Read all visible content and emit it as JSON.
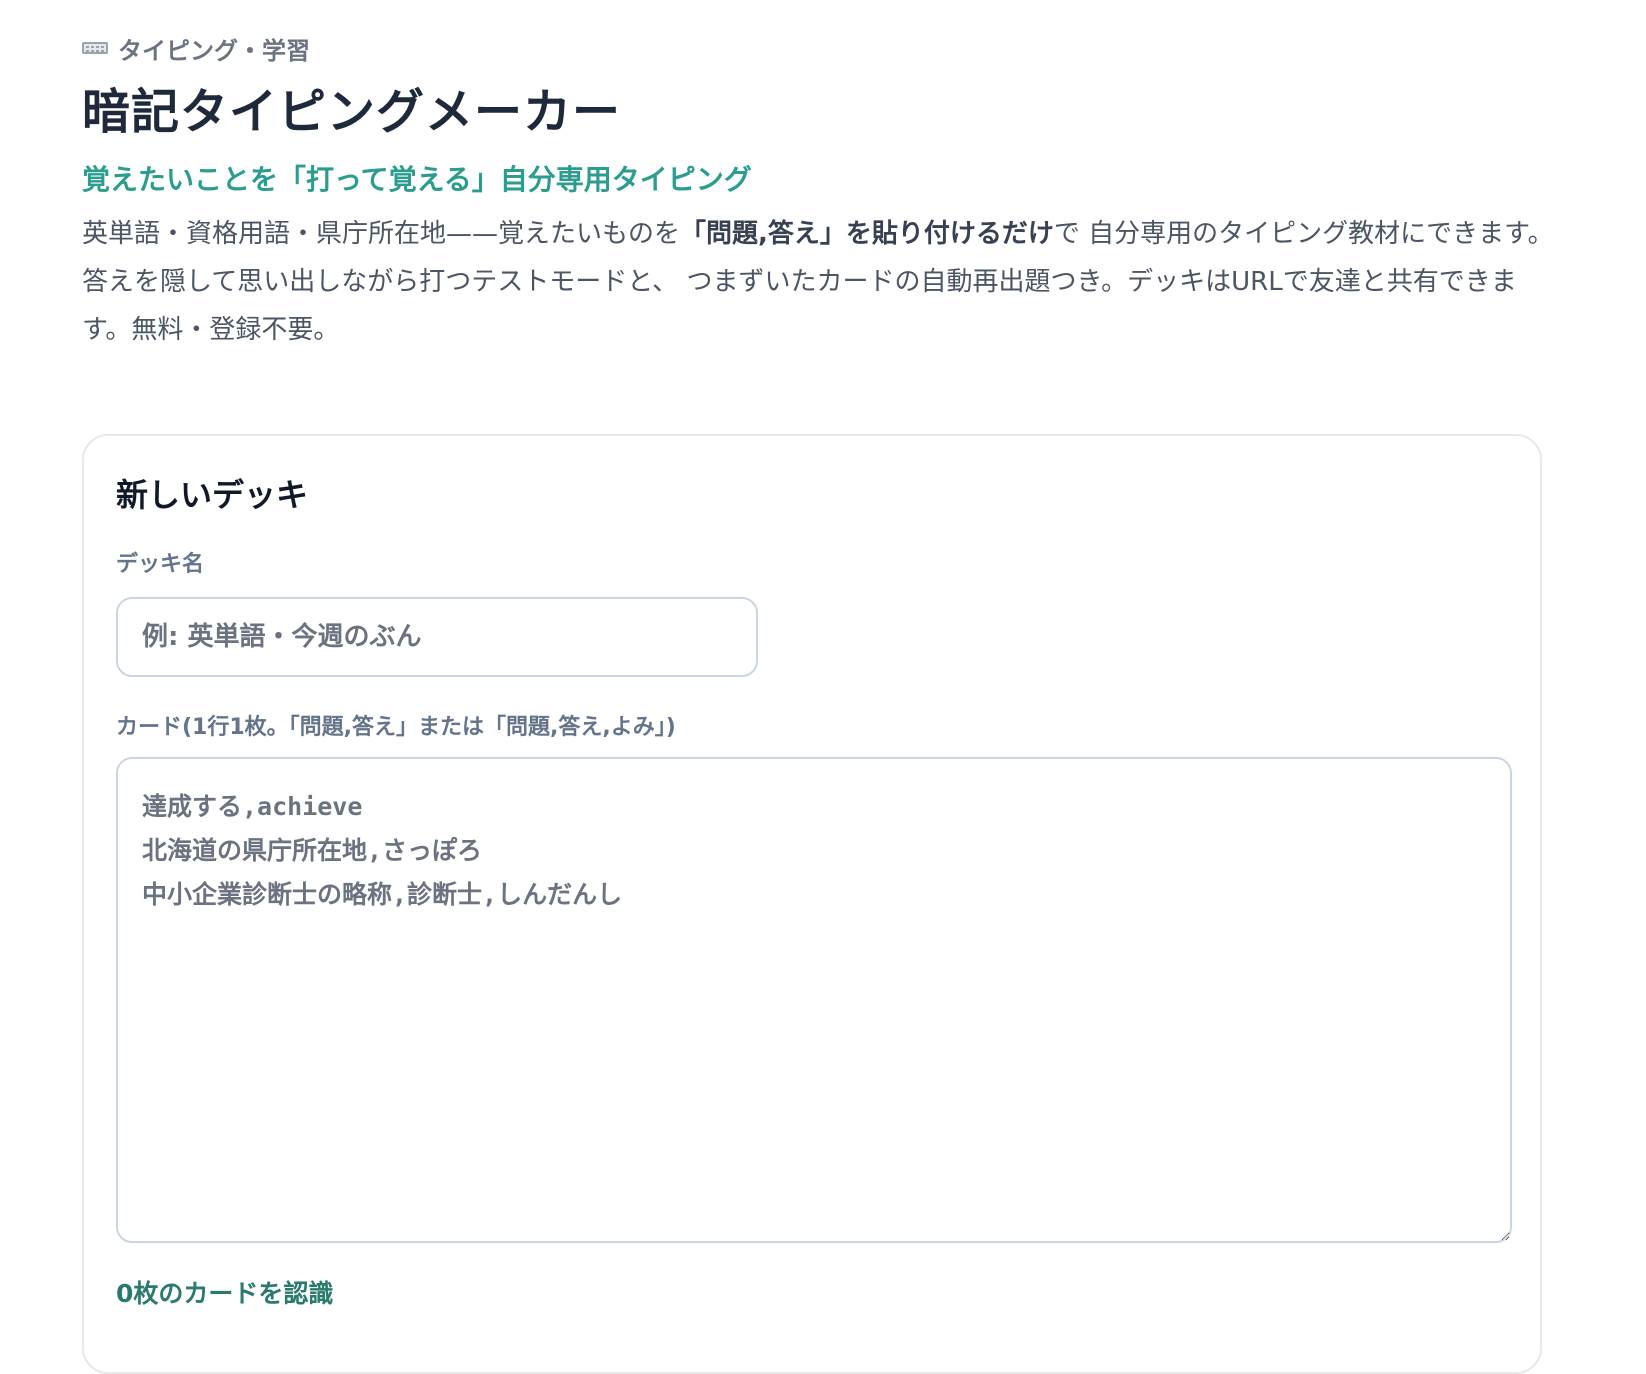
{
  "header": {
    "category_icon": "keyboard-icon",
    "category": "タイピング・学習",
    "title": "暗記タイピングメーカー",
    "subtitle": "覚えたいことを「打って覚える」自分専用タイピング",
    "description_part1": "英単語・資格用語・県庁所在地——覚えたいものを",
    "description_bold": "「問題,答え」を貼り付けるだけ",
    "description_part2": "で 自分専用のタイピング教材にできます。答えを隠して思い出しながら打つテストモードと、 つまずいたカードの自動再出題つき。デッキはURLで友達と共有できます。無料・登録不要。"
  },
  "deck_form": {
    "title": "新しいデッキ",
    "name_label": "デッキ名",
    "name_value": "",
    "name_placeholder": "例: 英単語・今週のぶん",
    "cards_label": "カード(1行1枚。「問題,答え」または「問題,答え,よみ」)",
    "cards_value": "",
    "cards_placeholder": "達成する,achieve\n北海道の県庁所在地,さっぽろ\n中小企業診断士の略称,診断士,しんだんし",
    "card_count_text": "0枚のカードを認識"
  },
  "colors": {
    "accent": "#2a9d8f",
    "count_text": "#2a7a6e",
    "title": "#1e293b",
    "body_text": "#4b5563",
    "border": "#cbd5e1"
  }
}
